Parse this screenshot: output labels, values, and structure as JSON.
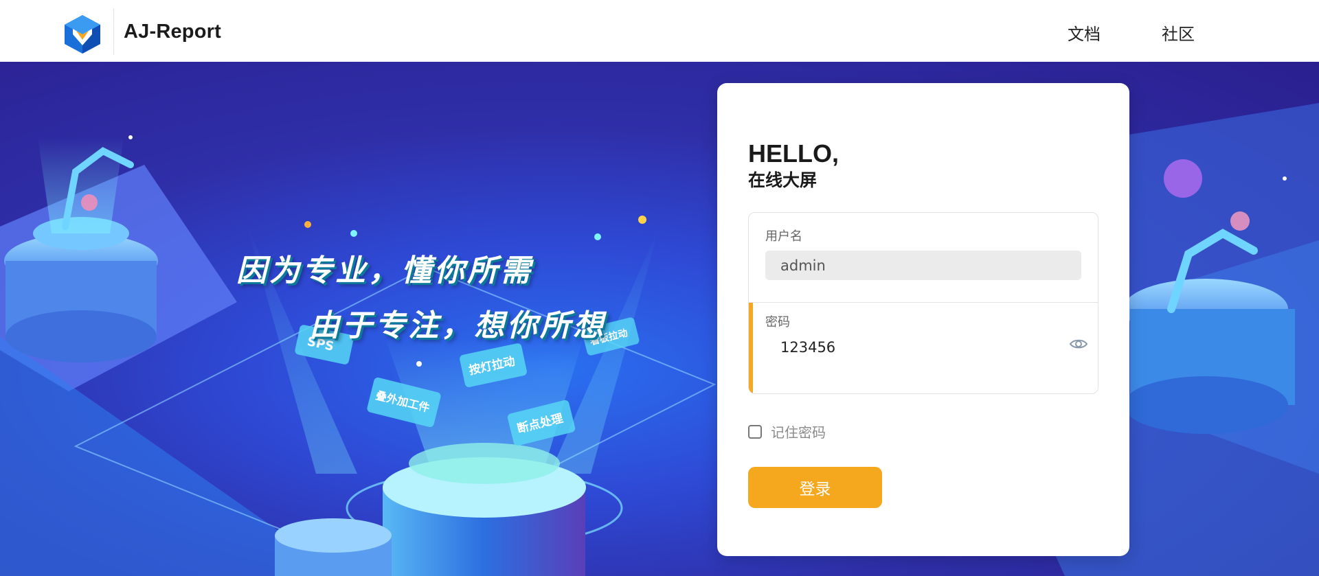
{
  "header": {
    "brand": "AJ-Report",
    "nav": [
      {
        "label": "文档"
      },
      {
        "label": "社区"
      }
    ]
  },
  "hero": {
    "slogan_line1": "因为专业，懂你所需",
    "slogan_line2": "由于专注，想你所想",
    "floating_tags": [
      "SPS",
      "叠外加工件",
      "按灯拉动",
      "断点处理",
      "看板拉动"
    ]
  },
  "login": {
    "greeting": "HELLO,",
    "subtitle": "在线大屏",
    "username_label": "用户名",
    "username_value": "admin",
    "password_label": "密码",
    "password_value": "123456",
    "remember_label": "记住密码",
    "remember_checked": false,
    "submit_label": "登录"
  },
  "colors": {
    "accent": "#f5a81d",
    "hero_dark": "#2a1f8f",
    "hero_light": "#2a6ff0"
  },
  "icons": {
    "logo": "aj-report-cube-logo",
    "password_toggle": "eye-icon"
  }
}
